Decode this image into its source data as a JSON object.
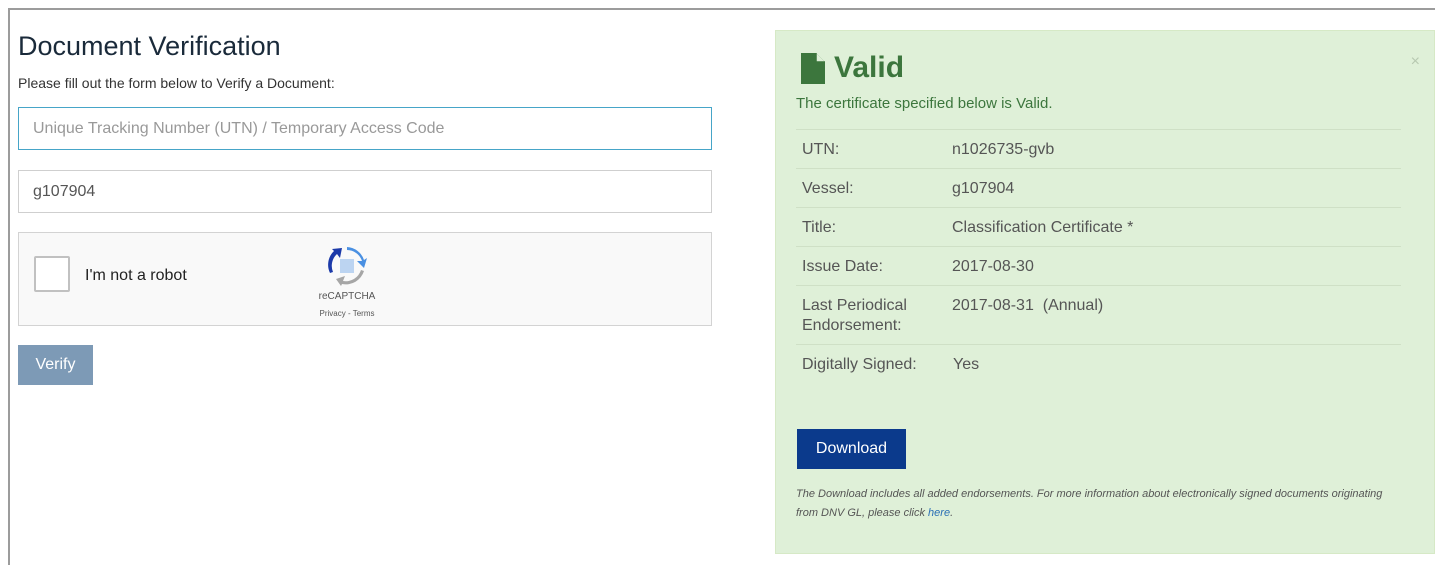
{
  "form": {
    "title": "Document Verification",
    "subtitle": "Please fill out the form below to Verify a Document:",
    "utn_placeholder": "Unique Tracking Number (UTN) / Temporary Access Code",
    "utn_value": "",
    "vessel_value": "g107904",
    "captcha": {
      "label": "I'm not a robot",
      "brand": "reCAPTCHA",
      "links": "Privacy - Terms",
      "checked": false
    },
    "verify_label": "Verify"
  },
  "result": {
    "status": "Valid",
    "message": "The certificate specified below is Valid.",
    "close": "×",
    "details": [
      {
        "key": "UTN:",
        "value": "n1026735-gvb"
      },
      {
        "key": "Vessel:",
        "value": "g107904"
      },
      {
        "key": "Title:",
        "value": "Classification Certificate *"
      },
      {
        "key": "Issue Date:",
        "value": "2017-08-30"
      },
      {
        "key": "Last Periodical Endorsement:",
        "value": "2017-08-31  (Annual)"
      },
      {
        "key": "Digitally Signed:",
        "value": "Yes"
      }
    ],
    "download_label": "Download",
    "footnote_text": "The Download includes all added endorsements. For more information about electronically signed documents originating from DNV GL, please click",
    "footnote_link": "here",
    "footnote_end": "."
  },
  "colors": {
    "panel_bg": "#dff0d8",
    "success_text": "#3c763d",
    "download_btn": "#0b3a8c",
    "verify_btn": "#7d9ab6",
    "focus_border": "#46a5c8"
  },
  "icons": {
    "status_icon": "document-icon",
    "captcha_icon": "recaptcha-logo-icon"
  }
}
